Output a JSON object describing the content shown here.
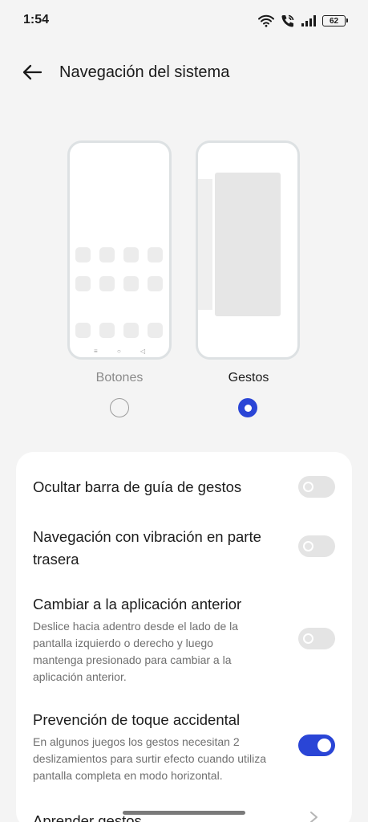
{
  "status_bar": {
    "time": "1:54",
    "battery_level": "62",
    "icons": [
      "wifi-icon",
      "wifi-call-icon",
      "signal-icon",
      "battery-icon"
    ]
  },
  "header": {
    "title": "Navegación del sistema"
  },
  "modes": {
    "buttons": {
      "label": "Botones",
      "selected": false,
      "nav_keys": [
        "≡",
        "○",
        "◁"
      ]
    },
    "gestures": {
      "label": "Gestos",
      "selected": true
    }
  },
  "settings": [
    {
      "title": "Ocultar barra de guía de gestos",
      "description": "",
      "toggle": false
    },
    {
      "title": "Navegación con vibración en parte trasera",
      "description": "",
      "toggle": false
    },
    {
      "title": "Cambiar a la aplicación anterior",
      "description": "Deslice hacia adentro desde el lado de la pantalla izquierdo o derecho y luego mantenga presionado para cambiar a la aplicación anterior.",
      "toggle": false
    },
    {
      "title": "Prevención de toque accidental",
      "description": "En algunos juegos los gestos necesitan 2 deslizamientos para surtir efecto cuando utiliza pantalla completa en modo horizontal.",
      "toggle": true
    },
    {
      "title": "Aprender gestos",
      "description": ""
    }
  ],
  "colors": {
    "accent": "#2a45d6",
    "background": "#f4f4f4",
    "card": "#ffffff"
  }
}
